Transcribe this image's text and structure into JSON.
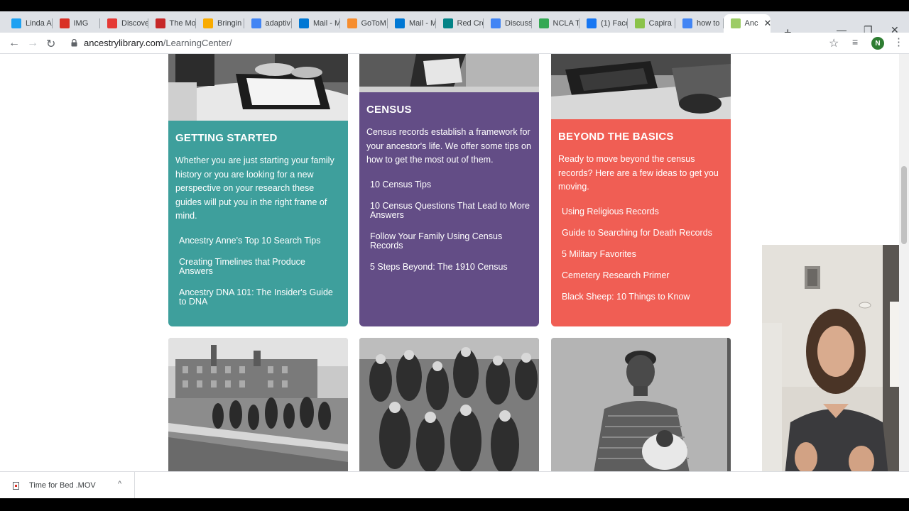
{
  "browser": {
    "tabs": [
      {
        "label": "Linda A",
        "icon_color": "#1da1f2",
        "icon": "twitter-icon"
      },
      {
        "label": "IMG",
        "icon_color": "#d93025",
        "icon": "clapper-icon"
      },
      {
        "label": "Discove",
        "icon_color": "#e53935",
        "icon": "heart-icon"
      },
      {
        "label": "The Mo",
        "icon_color": "#c62828",
        "icon": "swirl-icon"
      },
      {
        "label": "Bringin",
        "icon_color": "#f9ab00",
        "icon": "drive-icon"
      },
      {
        "label": "adaptiv",
        "icon_color": "#4285f4",
        "icon": "google-icon"
      },
      {
        "label": "Mail - M",
        "icon_color": "#0078d4",
        "icon": "outlook-icon"
      },
      {
        "label": "GoToM",
        "icon_color": "#f68d2e",
        "icon": "gotomeeting-icon"
      },
      {
        "label": "Mail - M",
        "icon_color": "#0078d4",
        "icon": "outlook-icon"
      },
      {
        "label": "Red Cro",
        "icon_color": "#038387",
        "icon": "sway-icon"
      },
      {
        "label": "Discuss",
        "icon_color": "#4285f4",
        "icon": "docs-icon"
      },
      {
        "label": "NCLA T",
        "icon_color": "#34a853",
        "icon": "drive-icon"
      },
      {
        "label": "(1) Face",
        "icon_color": "#1877f2",
        "icon": "facebook-icon"
      },
      {
        "label": "Capira",
        "icon_color": "#8bc34a",
        "icon": "capira-icon"
      },
      {
        "label": "how to",
        "icon_color": "#4285f4",
        "icon": "google-icon"
      },
      {
        "label": "Anc",
        "icon_color": "#9ccc65",
        "icon": "ancestry-leaf-icon",
        "active": true
      }
    ],
    "new_tab": "+",
    "window_controls": {
      "minimize": "—",
      "restore": "❐",
      "close": "✕"
    },
    "nav": {
      "back": "←",
      "forward": "→",
      "reload": "↻"
    },
    "address": {
      "host": "ancestrylibrary.com",
      "path": "/LearningCenter/"
    },
    "profile_initial": "N"
  },
  "cards": {
    "getting_started": {
      "title": "GETTING STARTED",
      "description": "Whether you are just starting your family history or you are looking for a new perspective on your research these guides will put you in the right frame of mind.",
      "links": [
        "Ancestry Anne's Top 10 Search Tips",
        "Creating Timelines that Produce Answers",
        "Ancestry DNA 101: The Insider's Guide to DNA"
      ],
      "color": "#3e9f9c"
    },
    "census": {
      "title": "CENSUS",
      "description": "Census records establish a framework for your ancestor's life. We offer some tips on how to get the most out of them.",
      "links": [
        "10 Census Tips",
        "10 Census Questions That Lead to More Answers",
        "Follow Your Family Using Census Records",
        "5 Steps Beyond: The 1910 Census"
      ],
      "color": "#634d86"
    },
    "beyond_basics": {
      "title": "BEYOND THE BASICS",
      "description": "Ready to move beyond the census records? Here are a few ideas to get you moving.",
      "links": [
        "Using Religious Records",
        "Guide to Searching for Death Records",
        "5 Military Favorites",
        "Cemetery Research Primer",
        "Black Sheep: 10 Things to Know"
      ],
      "color": "#f05e54"
    }
  },
  "downloads": {
    "file_name": "Time for Bed .MOV",
    "chevron": "^"
  }
}
